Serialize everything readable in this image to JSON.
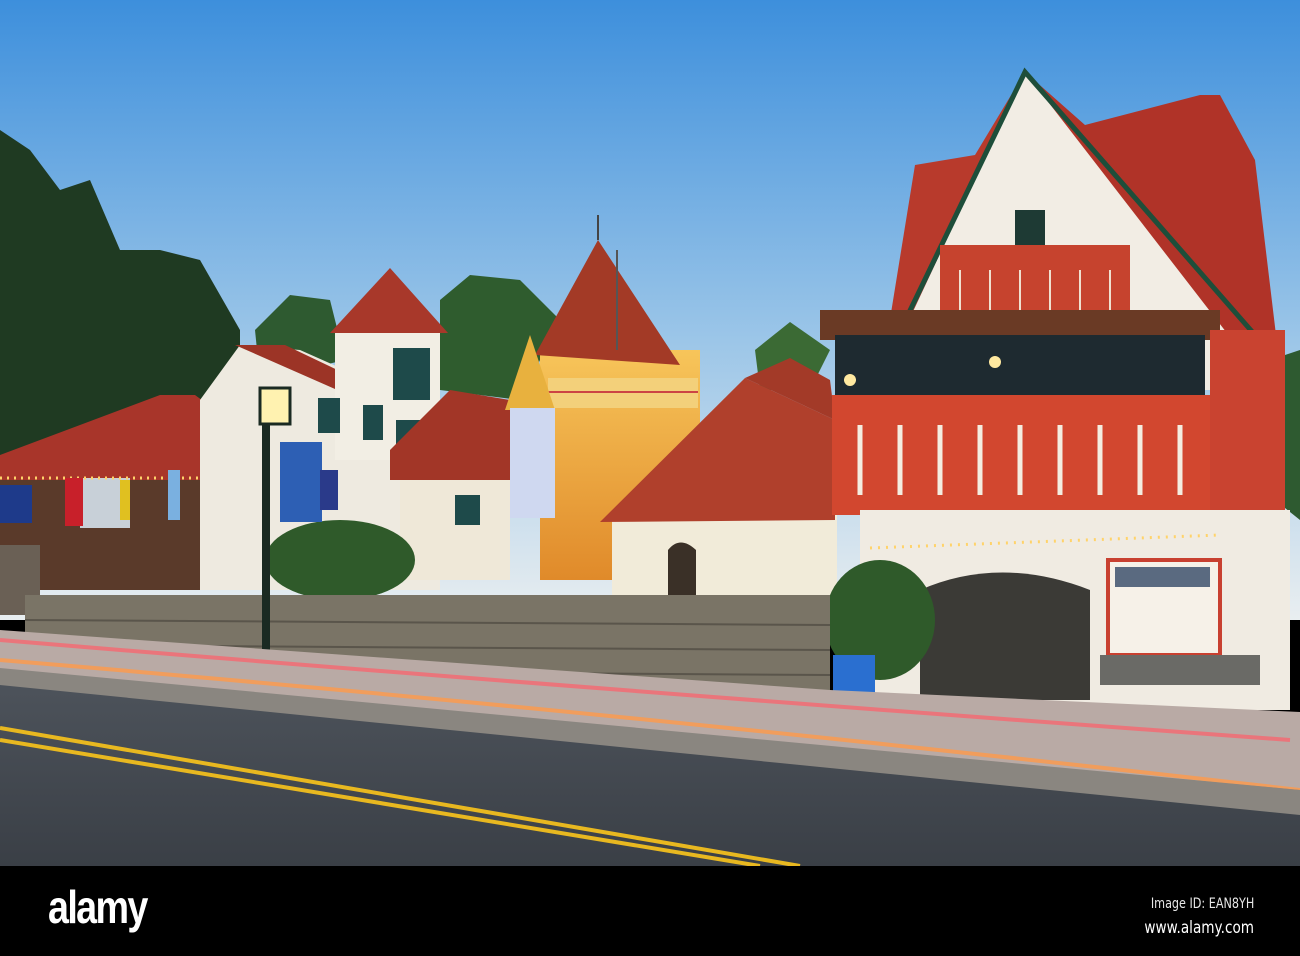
{
  "footer": {
    "logo": "alamy",
    "image_id": "Image ID: EAN8YH",
    "url": "www.alamy.com"
  }
}
